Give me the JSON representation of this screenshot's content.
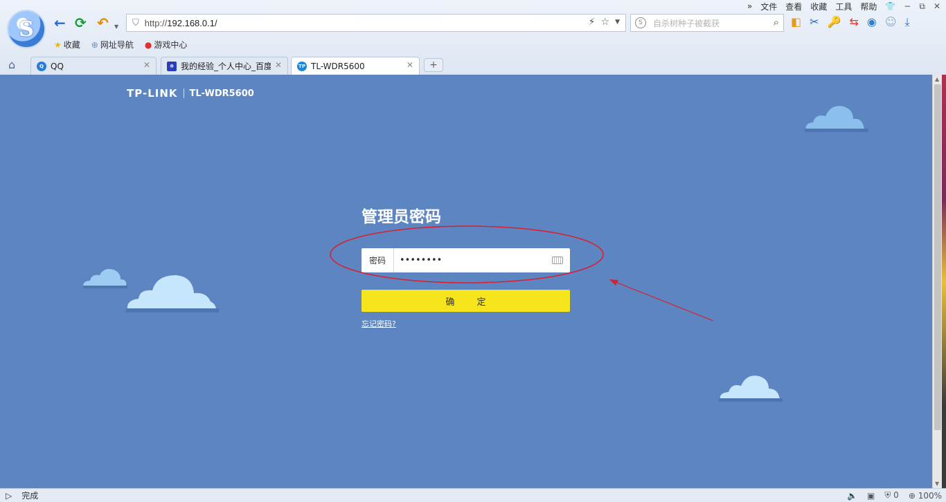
{
  "browser": {
    "menu": [
      "»",
      "文件",
      "查看",
      "收藏",
      "工具",
      "帮助"
    ],
    "window_buttons": [
      "−",
      "⧉",
      "✕"
    ],
    "address_url_prefix": "http://",
    "address_url_host": "192.168.0.1/",
    "search_placeholder": "自杀树种子被截获",
    "bookmarks": [
      "收藏",
      "网址导航",
      "游戏中心"
    ],
    "tabs": [
      {
        "label": "QQ",
        "icon": "qq-icon"
      },
      {
        "label": "我的经验_个人中心_百度",
        "icon": "baidu-paw-icon"
      },
      {
        "label": "TL-WDR5600",
        "icon": "tplink-icon"
      }
    ],
    "status_text": "完成",
    "status_right": [
      "0",
      "100%"
    ]
  },
  "page": {
    "brand": "TP-LINK",
    "model": "TL-WDR5600",
    "title": "管理员密码",
    "password_label": "密码",
    "password_value": "••••••••",
    "confirm_label": "确 定",
    "forgot_link": "忘记密码?"
  },
  "colors": {
    "page_background": "#5c85c2",
    "confirm_button": "#f6e41c",
    "annotation": "#d9202e",
    "cloud": "#c6e6fb"
  }
}
